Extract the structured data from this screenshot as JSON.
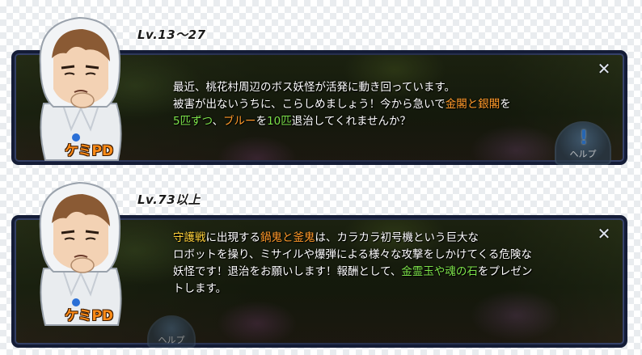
{
  "panels": [
    {
      "level": "Lv.13〜27",
      "npc_name": "ケミPD",
      "help_label": "ヘルプ",
      "close": "✕",
      "lines": [
        [
          "最近、桃花村周辺のボス妖怪が活発に動き回っています。"
        ],
        [
          "被害が出ないうちに、こらしめましょう！今から急いで",
          "金閣",
          "と",
          "銀閣",
          "を"
        ],
        [
          "5匹ずつ",
          "、",
          "ブルー",
          "を",
          "10匹",
          "退治してくれませんか？"
        ]
      ]
    },
    {
      "level": "Lv.73以上",
      "npc_name": "ケミPD",
      "help_label": "ヘルプ",
      "close": "✕",
      "lines": [
        [
          "守護戦",
          "に出現する",
          "鍋鬼と釜鬼",
          "は、カラカラ初号機という巨大な"
        ],
        [
          "ロボットを操り、ミサイルや爆弾による様々な攻撃をしかけてくる危険な"
        ],
        [
          "妖怪です！退治をお願いします！報酬として、",
          "金霊玉や魂の石",
          "をプレゼン"
        ],
        [
          "トします。"
        ]
      ]
    }
  ],
  "colors": {
    "highlight_orange": "#ff9a2a",
    "highlight_green": "#7de24a",
    "highlight_yellow": "#ffd23a",
    "npc_name": "#ff8c18"
  }
}
